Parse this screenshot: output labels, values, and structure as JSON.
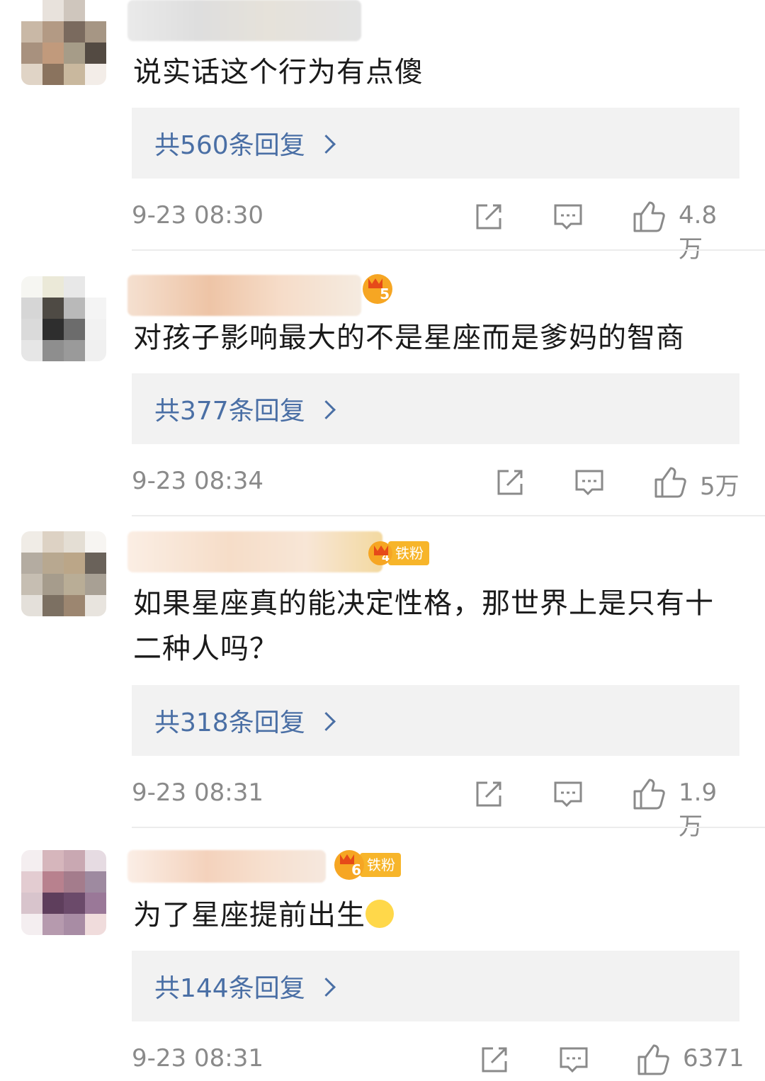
{
  "comments": [
    {
      "text": "说实话这个行为有点傻",
      "reply_label": "共560条回复",
      "time": "9-23 08:30",
      "likes": "4.8万"
    },
    {
      "text": "对孩子影响最大的不是星座而是爹妈的智商",
      "reply_label": "共377条回复",
      "time": "9-23 08:34",
      "likes": "5万"
    },
    {
      "text": "如果星座真的能决定性格，那世界上是只有十二种人吗？",
      "reply_label": "共318条回复",
      "time": "9-23 08:31",
      "likes": "1.9万",
      "fan_badge": "铁粉"
    },
    {
      "text": "为了星座提前出生",
      "reply_label": "共144条回复",
      "time": "9-23 08:31",
      "likes": "6371",
      "fan_badge": "铁粉"
    }
  ],
  "icons": {
    "share": "share-icon",
    "comment": "comment-icon",
    "like": "thumbs-up-icon",
    "emoji": "sweat-emoji-icon"
  },
  "colors": {
    "reply_link": "#4a6fa5",
    "meta_gray": "#8a8a8a",
    "reply_bg": "#f2f2f2",
    "fan_badge": "#f7b52a"
  }
}
